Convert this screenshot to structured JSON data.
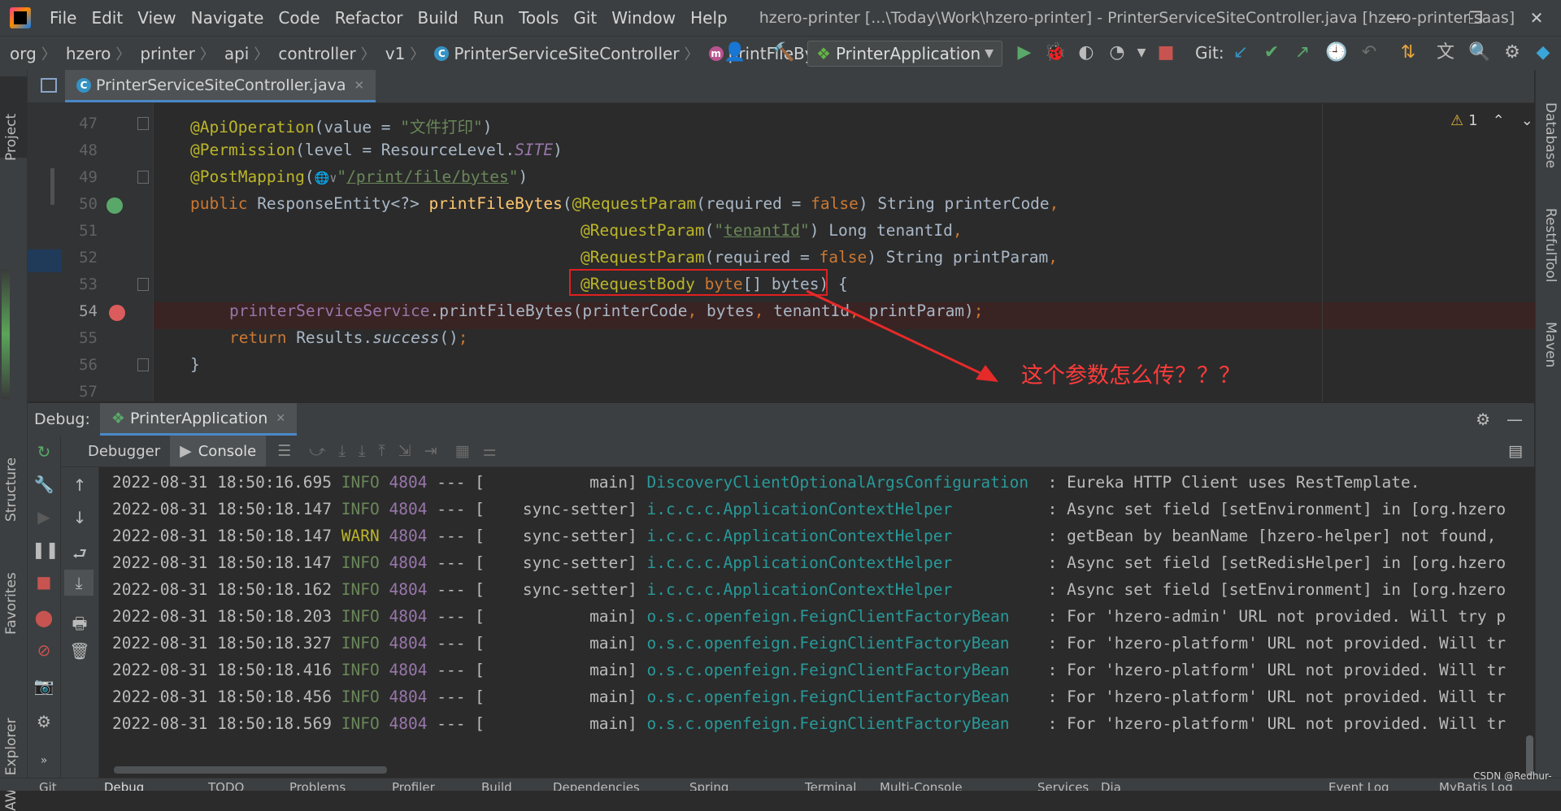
{
  "window": {
    "title": "hzero-printer [...\\Today\\Work\\hzero-printer] - PrinterServiceSiteController.java [hzero-printer-saas]"
  },
  "menu": [
    "File",
    "Edit",
    "View",
    "Navigate",
    "Code",
    "Refactor",
    "Build",
    "Run",
    "Tools",
    "Git",
    "Window",
    "Help"
  ],
  "breadcrumb": [
    "org",
    "hzero",
    "printer",
    "api",
    "controller",
    "v1",
    "PrinterServiceSiteController",
    "printFileBytes"
  ],
  "toolbar": {
    "run_config": "PrinterApplication",
    "git_label": "Git:"
  },
  "left_tools": {
    "project": "Project",
    "structure": "Structure",
    "favorites": "Favorites",
    "aws": "AWS Explorer"
  },
  "right_tools": {
    "database": "Database",
    "restful": "RestfulTool",
    "maven": "Maven"
  },
  "editor": {
    "tab": "PrinterServiceSiteController.java",
    "inspection_count": "1",
    "line_numbers": [
      "47",
      "48",
      "49",
      "50",
      "51",
      "52",
      "53",
      "54",
      "55",
      "56",
      "57"
    ],
    "code": {
      "l47": {
        "ann": "@ApiOperation",
        "a": "(value = ",
        "s": "\"文件打印\"",
        "b": ")"
      },
      "l48": {
        "ann": "@Permission",
        "a": "(level = ResourceLevel.",
        "f": "SITE",
        "b": ")"
      },
      "l49": {
        "ann": "@PostMapping",
        "a": "(",
        "globe": "🌐∨",
        "q1": "\"",
        "url": "/print/file/bytes",
        "q2": "\"",
        "b": ")"
      },
      "l50": {
        "kw": "public",
        "type": " ResponseEntity<?> ",
        "fn": "printFileBytes",
        "p": "(",
        "ann": "@RequestParam",
        "a": "(required = ",
        "kw2": "false",
        "b": ") String printerCode",
        "c": ","
      },
      "l51": {
        "ann": "@RequestParam",
        "a": "(",
        "q1": "\"",
        "u": "tenantId",
        "q2": "\"",
        "b": ") Long tenantId",
        "c": ","
      },
      "l52": {
        "ann": "@RequestParam",
        "a": "(required = ",
        "kw2": "false",
        "b": ") String printParam",
        "c": ","
      },
      "l53": {
        "ann": "@RequestBody",
        "kw": " byte",
        "b": "[] bytes",
        "p": ")",
        "c": " {"
      },
      "l54": {
        "field": "printerServiceService",
        "a": ".printFileBytes(printerCode",
        "c1": ",",
        "b": " bytes",
        "c2": ",",
        "d": " tenantId",
        "c3": ",",
        "e": " printParam)",
        "c4": ";"
      },
      "l55": {
        "kw": "return",
        "a": " Results.",
        "m": "success",
        "b": "()",
        "c": ";"
      },
      "l56": {
        "a": "}"
      }
    },
    "annotation_text": "这个参数怎么传？？？"
  },
  "debug": {
    "label": "Debug:",
    "session": "PrinterApplication",
    "tabs": {
      "debugger": "Debugger",
      "console": "Console"
    }
  },
  "console_rows": [
    {
      "ts": "2022-08-31 18:50:16.695",
      "level": "INFO",
      "pid": "4804",
      "sep": "--- [",
      "thread": "          main]",
      "logger": "DiscoveryClientOptionalArgsConfiguration",
      "msg": " : Eureka HTTP Client uses RestTemplate."
    },
    {
      "ts": "2022-08-31 18:50:18.147",
      "level": "INFO",
      "pid": "4804",
      "sep": "--- [",
      "thread": "   sync-setter]",
      "logger": "i.c.c.c.ApplicationContextHelper        ",
      "msg": " : Async set field [setEnvironment] in [org.hzero"
    },
    {
      "ts": "2022-08-31 18:50:18.147",
      "level": "WARN",
      "pid": "4804",
      "sep": "--- [",
      "thread": "   sync-setter]",
      "logger": "i.c.c.c.ApplicationContextHelper        ",
      "msg": " : getBean by beanName [hzero-helper] not found,"
    },
    {
      "ts": "2022-08-31 18:50:18.147",
      "level": "INFO",
      "pid": "4804",
      "sep": "--- [",
      "thread": "   sync-setter]",
      "logger": "i.c.c.c.ApplicationContextHelper        ",
      "msg": " : Async set field [setRedisHelper] in [org.hzero"
    },
    {
      "ts": "2022-08-31 18:50:18.162",
      "level": "INFO",
      "pid": "4804",
      "sep": "--- [",
      "thread": "   sync-setter]",
      "logger": "i.c.c.c.ApplicationContextHelper        ",
      "msg": " : Async set field [setEnvironment] in [org.hzero"
    },
    {
      "ts": "2022-08-31 18:50:18.203",
      "level": "INFO",
      "pid": "4804",
      "sep": "--- [",
      "thread": "          main]",
      "logger": "o.s.c.openfeign.FeignClientFactoryBean  ",
      "msg": " : For 'hzero-admin' URL not provided. Will try p"
    },
    {
      "ts": "2022-08-31 18:50:18.327",
      "level": "INFO",
      "pid": "4804",
      "sep": "--- [",
      "thread": "          main]",
      "logger": "o.s.c.openfeign.FeignClientFactoryBean  ",
      "msg": " : For 'hzero-platform' URL not provided. Will tr"
    },
    {
      "ts": "2022-08-31 18:50:18.416",
      "level": "INFO",
      "pid": "4804",
      "sep": "--- [",
      "thread": "          main]",
      "logger": "o.s.c.openfeign.FeignClientFactoryBean  ",
      "msg": " : For 'hzero-platform' URL not provided. Will tr"
    },
    {
      "ts": "2022-08-31 18:50:18.456",
      "level": "INFO",
      "pid": "4804",
      "sep": "--- [",
      "thread": "          main]",
      "logger": "o.s.c.openfeign.FeignClientFactoryBean  ",
      "msg": " : For 'hzero-platform' URL not provided. Will tr"
    },
    {
      "ts": "2022-08-31 18:50:18.569",
      "level": "INFO",
      "pid": "4804",
      "sep": "--- [",
      "thread": "          main]",
      "logger": "o.s.c.openfeign.FeignClientFactoryBean  ",
      "msg": " : For 'hzero-platform' URL not provided. Will tr"
    }
  ],
  "bottom_tools": [
    "Git",
    "Debug",
    "TODO",
    "Problems",
    "Profiler",
    "Build",
    "Dependencies",
    "Spring",
    "Terminal",
    "Multi-Console",
    "Services",
    "Dia",
    "Event Log",
    "MyBatis Log"
  ],
  "watermark": "CSDN @Redhur-",
  "colors": {
    "accent": "#4a88c7",
    "annotation_red": "#e02020",
    "background": "#2b2b2b",
    "panel": "#3c3f41"
  }
}
